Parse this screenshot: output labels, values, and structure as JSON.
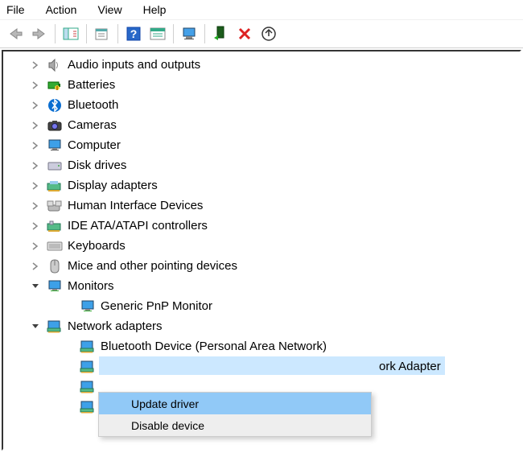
{
  "menu": {
    "file": "File",
    "action": "Action",
    "view": "View",
    "help": "Help"
  },
  "tree": {
    "items": [
      {
        "label": "Audio inputs and outputs",
        "icon": "speaker",
        "expanded": false
      },
      {
        "label": "Batteries",
        "icon": "battery",
        "expanded": false
      },
      {
        "label": "Bluetooth",
        "icon": "bluetooth",
        "expanded": false
      },
      {
        "label": "Cameras",
        "icon": "camera",
        "expanded": false
      },
      {
        "label": "Computer",
        "icon": "monitor",
        "expanded": false
      },
      {
        "label": "Disk drives",
        "icon": "disk",
        "expanded": false
      },
      {
        "label": "Display adapters",
        "icon": "display-adapter",
        "expanded": false
      },
      {
        "label": "Human Interface Devices",
        "icon": "hid",
        "expanded": false
      },
      {
        "label": "IDE ATA/ATAPI controllers",
        "icon": "ide",
        "expanded": false
      },
      {
        "label": "Keyboards",
        "icon": "keyboard",
        "expanded": false
      },
      {
        "label": "Mice and other pointing devices",
        "icon": "mouse",
        "expanded": false
      },
      {
        "label": "Monitors",
        "icon": "monitor-green",
        "expanded": true,
        "children": [
          {
            "label": "Generic PnP Monitor",
            "icon": "monitor-green"
          }
        ]
      },
      {
        "label": "Network adapters",
        "icon": "net-adapter",
        "expanded": true,
        "children": [
          {
            "label": "Bluetooth Device (Personal Area Network)",
            "icon": "net-adapter"
          },
          {
            "label": "ork Adapter",
            "icon": "net-adapter",
            "selected": true
          },
          {
            "label": "",
            "icon": "net-adapter"
          },
          {
            "label": "",
            "icon": "net-adapter"
          }
        ]
      }
    ]
  },
  "context_menu": {
    "items": [
      {
        "label": "Update driver"
      },
      {
        "label": "Disable device"
      }
    ],
    "highlighted": 0
  }
}
